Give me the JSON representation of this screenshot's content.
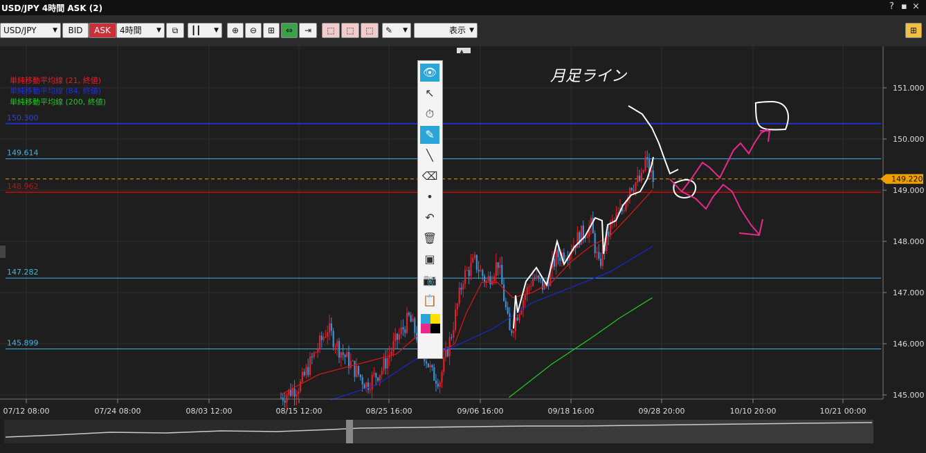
{
  "window": {
    "title": "USD/JPY 4時間 ASK (2)",
    "controls": [
      "?",
      "▪",
      "▪",
      "×"
    ]
  },
  "toolbar": {
    "symbol": "USD/JPY",
    "bid_label": "BID",
    "ask_label": "ASK",
    "timeframe": "4時間",
    "display_label": "表示"
  },
  "colors": {
    "background": "#1e1e1e",
    "bull": "#e0202a",
    "bear": "#3a8fd8",
    "sma21": "#d01818",
    "sma84": "#1a28c8",
    "sma200": "#22c422",
    "hline_light": "#3fb6ea",
    "hline_blue": "#2030c8",
    "hline_red": "#a01010",
    "current": "#f0a000",
    "pink": "#e82a8c"
  },
  "legend": [
    {
      "label": "単純移動平均線 (21, 終値)",
      "color": "#e0202a"
    },
    {
      "label": "単純移動平均線 (84, 終値)",
      "color": "#2030d8"
    },
    {
      "label": "単純移動平均線 (200, 終値)",
      "color": "#22c422"
    }
  ],
  "annotation_text": "月足ライン",
  "chart_data": {
    "type": "candlestick",
    "title": "",
    "xlabel": "",
    "ylabel": "",
    "ylim": [
      144.9,
      151.8
    ],
    "y_ticks": [
      "151.000",
      "150.000",
      "149.000",
      "148.000",
      "147.000",
      "146.000",
      "145.000"
    ],
    "x_ticks": [
      "07/12 08:00",
      "07/24 08:00",
      "08/03 12:00",
      "08/15 12:00",
      "08/25 16:00",
      "09/06 16:00",
      "09/18 16:00",
      "09/28 20:00",
      "10/10 20:00",
      "10/21 00:00"
    ],
    "current_price": "149.220",
    "horizontal_lines": [
      {
        "value": 150.3,
        "label": "150.300",
        "color": "#2030c8"
      },
      {
        "value": 149.614,
        "label": "149.614",
        "color": "#3fb6ea"
      },
      {
        "value": 148.96,
        "label": "148.962",
        "color": "#a01010"
      },
      {
        "value": 147.282,
        "label": "147.282",
        "color": "#3fb6ea"
      },
      {
        "value": 145.899,
        "label": "145.899",
        "color": "#3fb6ea"
      }
    ],
    "anchors": [
      {
        "bar": 0,
        "price": 144.95
      },
      {
        "bar": 10,
        "price": 145.2
      },
      {
        "bar": 16,
        "price": 145.7
      },
      {
        "bar": 24,
        "price": 146.3
      },
      {
        "bar": 30,
        "price": 145.9
      },
      {
        "bar": 38,
        "price": 145.5
      },
      {
        "bar": 44,
        "price": 145.2
      },
      {
        "bar": 52,
        "price": 145.5
      },
      {
        "bar": 60,
        "price": 146.1
      },
      {
        "bar": 66,
        "price": 146.5
      },
      {
        "bar": 72,
        "price": 146.0
      },
      {
        "bar": 78,
        "price": 145.4
      },
      {
        "bar": 82,
        "price": 145.3
      },
      {
        "bar": 88,
        "price": 146.2
      },
      {
        "bar": 94,
        "price": 147.3
      },
      {
        "bar": 100,
        "price": 147.6
      },
      {
        "bar": 106,
        "price": 147.2
      },
      {
        "bar": 112,
        "price": 147.6
      },
      {
        "bar": 118,
        "price": 146.2
      },
      {
        "bar": 124,
        "price": 146.8
      },
      {
        "bar": 130,
        "price": 147.3
      },
      {
        "bar": 136,
        "price": 147.1
      },
      {
        "bar": 142,
        "price": 147.7
      },
      {
        "bar": 148,
        "price": 147.8
      },
      {
        "bar": 154,
        "price": 148.1
      },
      {
        "bar": 160,
        "price": 148.3
      },
      {
        "bar": 164,
        "price": 147.5
      },
      {
        "bar": 170,
        "price": 148.3
      },
      {
        "bar": 176,
        "price": 148.6
      },
      {
        "bar": 180,
        "price": 149.1
      },
      {
        "bar": 186,
        "price": 149.2
      },
      {
        "bar": 188,
        "price": 149.6
      },
      {
        "bar": 192,
        "price": 149.2
      }
    ],
    "sma21": [
      [
        0,
        145.0
      ],
      [
        20,
        145.4
      ],
      [
        40,
        145.6
      ],
      [
        60,
        145.8
      ],
      [
        72,
        146.2
      ],
      [
        82,
        145.8
      ],
      [
        90,
        146.0
      ],
      [
        96,
        146.6
      ],
      [
        104,
        147.2
      ],
      [
        112,
        147.2
      ],
      [
        120,
        146.9
      ],
      [
        130,
        147.0
      ],
      [
        140,
        147.2
      ],
      [
        150,
        147.6
      ],
      [
        160,
        147.9
      ],
      [
        170,
        148.1
      ],
      [
        180,
        148.5
      ],
      [
        192,
        149.0
      ]
    ],
    "sma84": [
      [
        26,
        144.9
      ],
      [
        50,
        145.2
      ],
      [
        70,
        145.7
      ],
      [
        90,
        145.95
      ],
      [
        110,
        146.3
      ],
      [
        130,
        146.8
      ],
      [
        150,
        147.1
      ],
      [
        170,
        147.4
      ],
      [
        192,
        147.9
      ]
    ],
    "sma200": [
      [
        118,
        144.95
      ],
      [
        140,
        145.6
      ],
      [
        160,
        146.1
      ],
      [
        175,
        146.5
      ],
      [
        192,
        146.9
      ]
    ]
  },
  "drawing_tools": [
    {
      "name": "eye-icon",
      "glyph": "👁"
    },
    {
      "name": "pointer-icon",
      "glyph": "↖"
    },
    {
      "name": "stopwatch-icon",
      "glyph": "⏱"
    },
    {
      "name": "eraser-selected-icon",
      "glyph": "✎"
    },
    {
      "name": "line-icon",
      "glyph": "╲"
    },
    {
      "name": "eraser-icon",
      "glyph": "⌫"
    },
    {
      "name": "dot-icon",
      "glyph": "•"
    },
    {
      "name": "undo-icon",
      "glyph": "↶"
    },
    {
      "name": "trash-icon",
      "glyph": "🗑"
    },
    {
      "name": "projector-icon",
      "glyph": "▣"
    },
    {
      "name": "camera-icon",
      "glyph": "📷"
    },
    {
      "name": "clipboard-icon",
      "glyph": "📋"
    }
  ]
}
